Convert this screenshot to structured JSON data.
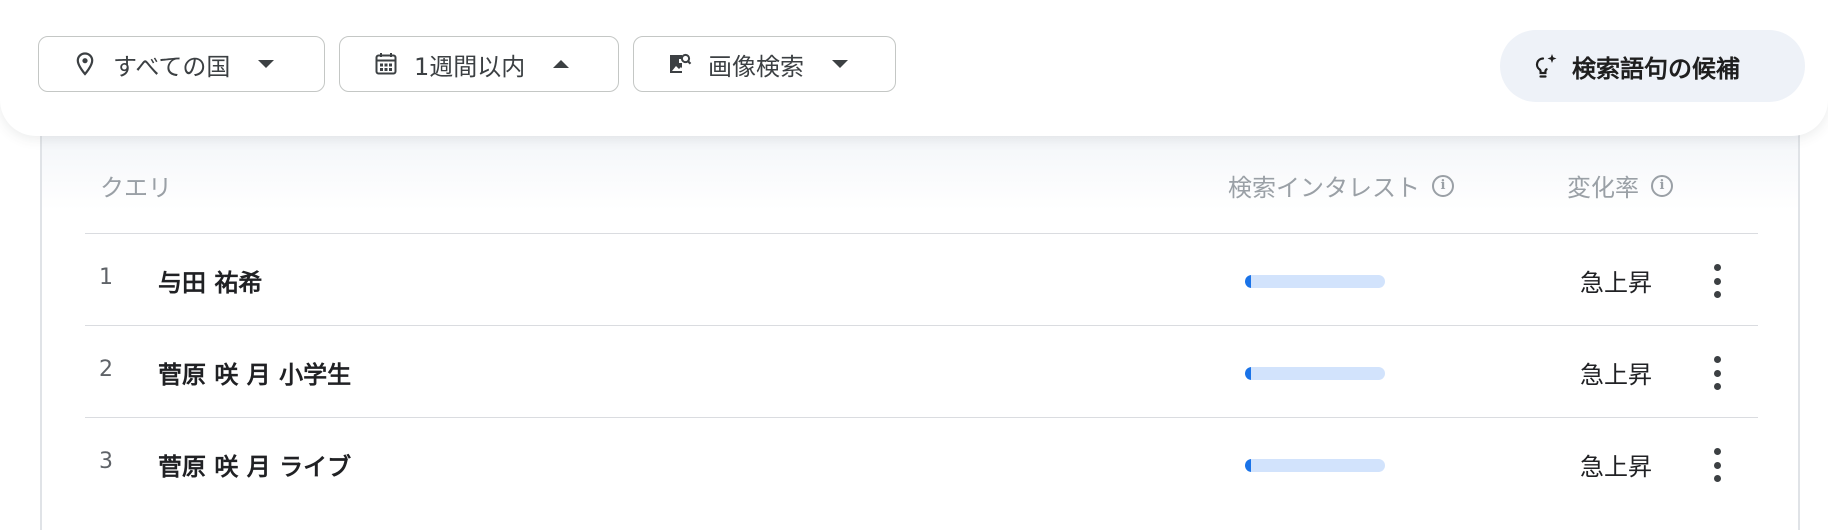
{
  "filters": {
    "location": {
      "label": "すべての国",
      "icon": "location-pin-icon"
    },
    "time": {
      "label": "1週間以内",
      "icon": "calendar-icon"
    },
    "search_type": {
      "label": "画像検索",
      "icon": "image-search-icon"
    }
  },
  "suggest_button": {
    "label": "検索語句の候補",
    "icon": "lightbulb-sparkle-icon"
  },
  "table": {
    "headers": {
      "query": "クエリ",
      "interest": "検索インタレスト",
      "change": "変化率"
    },
    "rows": [
      {
        "rank": "1",
        "term": "与田 祐希",
        "interest": 0.04,
        "change": "急上昇"
      },
      {
        "rank": "2",
        "term": "菅原 咲 月 小学生",
        "interest": 0.04,
        "change": "急上昇"
      },
      {
        "rank": "3",
        "term": "菅原 咲 月 ライブ",
        "interest": 0.04,
        "change": "急上昇"
      }
    ]
  },
  "colors": {
    "accent": "#1a73e8",
    "bar_track": "#d2e3fc",
    "suggest_bg": "#eef2f8"
  }
}
